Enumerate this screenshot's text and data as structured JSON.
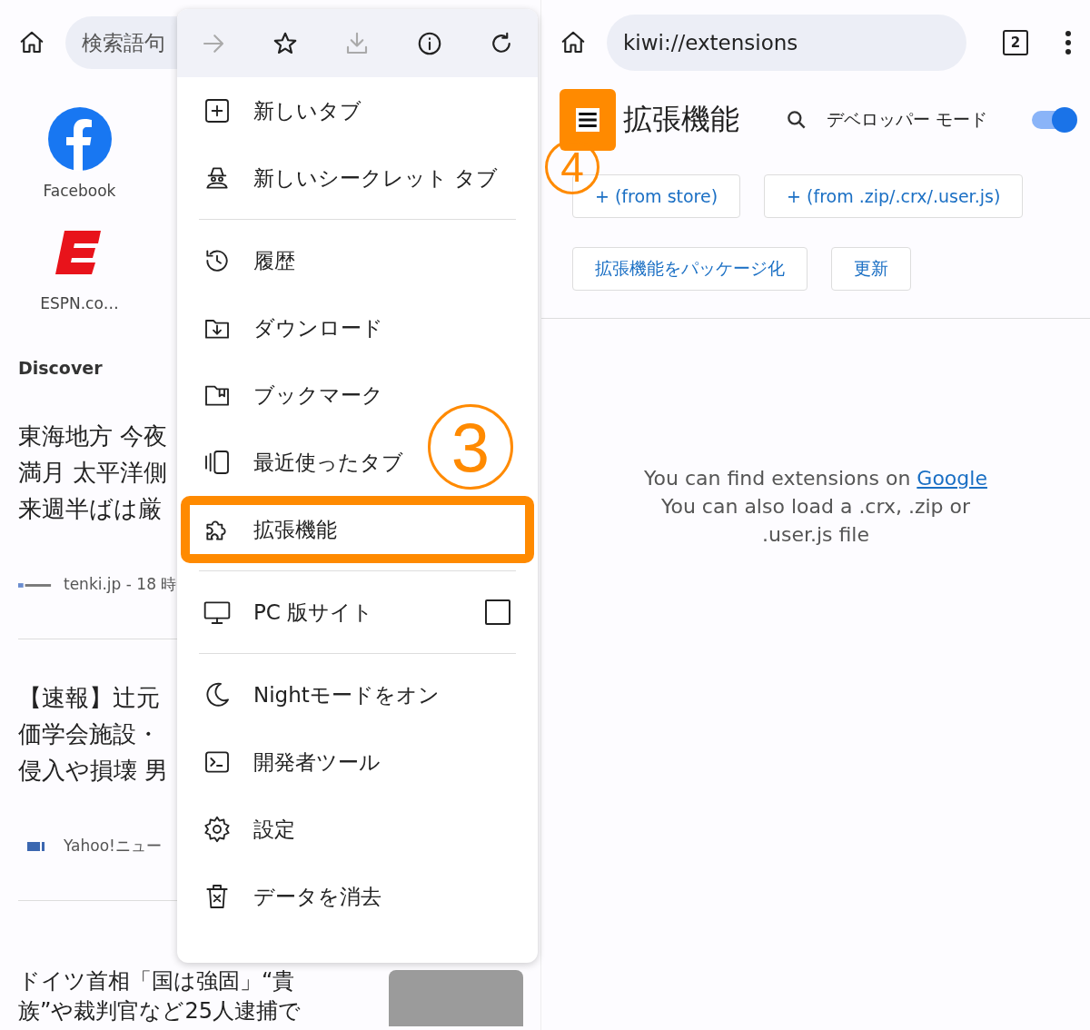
{
  "left_screen": {
    "search_placeholder": "検索語句",
    "shortcuts": [
      {
        "label": "Facebook",
        "kind": "facebook"
      },
      {
        "label": "ESPN.co…",
        "kind": "espn"
      }
    ],
    "discover_heading": "Discover",
    "articles": [
      {
        "lines": [
          "東海地方 今夜",
          "満月 太平洋側",
          "来週半ばは厳"
        ],
        "source": "tenki.jp - 18 時",
        "kind": "tenki"
      },
      {
        "lines": [
          "【速報】辻元",
          "価学会施設・",
          "侵入や損壊 男"
        ],
        "source": "Yahoo!ニュー",
        "kind": "yahoo"
      },
      {
        "lines": [
          "ドイツ首相「国は強固」“貴",
          "族”や裁判官など25人逮捕で"
        ],
        "kind": "photo"
      }
    ],
    "menu": {
      "actions": [
        {
          "kind": "forward",
          "disabled": true
        },
        {
          "kind": "star",
          "disabled": false
        },
        {
          "kind": "download",
          "disabled": true
        },
        {
          "kind": "info",
          "disabled": false
        },
        {
          "kind": "reload",
          "disabled": false
        }
      ],
      "items": [
        {
          "kind": "item",
          "label": "新しいタブ",
          "annotated": false
        },
        {
          "kind": "item",
          "label": "新しいシークレット タブ",
          "annotated": false
        },
        {
          "kind": "divider"
        },
        {
          "kind": "item",
          "label": "履歴",
          "annotated": false
        },
        {
          "kind": "item",
          "label": "ダウンロード",
          "annotated": false
        },
        {
          "kind": "item",
          "label": "ブックマーク",
          "annotated": false
        },
        {
          "kind": "item",
          "label": "最近使ったタブ",
          "annotated": false
        },
        {
          "kind": "item",
          "label": "拡張機能",
          "annotated": true
        },
        {
          "kind": "divider"
        },
        {
          "kind": "checkbox",
          "label": "PC 版サイト",
          "checked": false,
          "annotated": false
        },
        {
          "kind": "divider"
        },
        {
          "kind": "item",
          "label": "Nightモードをオン",
          "annotated": false
        },
        {
          "kind": "item",
          "label": "開発者ツール",
          "annotated": false
        },
        {
          "kind": "item",
          "label": "設定",
          "annotated": false
        },
        {
          "kind": "item",
          "label": "データを消去",
          "annotated": false
        }
      ],
      "annotation": "3"
    }
  },
  "right_screen": {
    "url": "kiwi://extensions",
    "tab_count": "2",
    "title": "拡張機能",
    "menu_annotated": true,
    "developer_mode": {
      "label": "デベロッパー モード",
      "on": true
    },
    "buttons": [
      "+ (from store)",
      "+ (from .zip/.crx/.user.js)",
      "拡張機能をパッケージ化",
      "更新"
    ],
    "annotation": "4",
    "message": {
      "line_1": "You can find extensions on",
      "link": "Google",
      "line_2": "You can also load a .crx, .zip or .user.js file"
    }
  }
}
